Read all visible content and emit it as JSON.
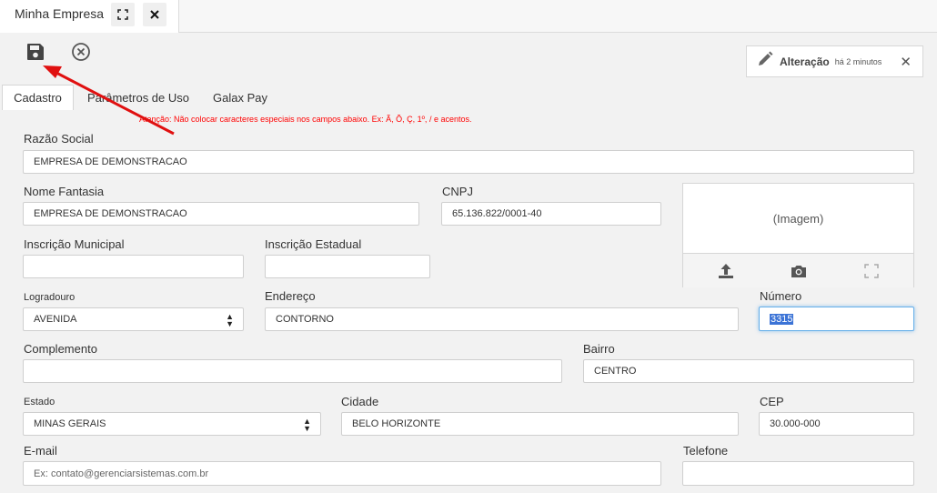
{
  "doc_tab": {
    "title": "Minha Empresa"
  },
  "notice": {
    "title": "Alteração",
    "time": "há 2 minutos",
    "close": "✕"
  },
  "tabs": [
    {
      "label": "Cadastro",
      "active": true
    },
    {
      "label": "Parâmetros de Uso",
      "active": false
    },
    {
      "label": "Galax Pay",
      "active": false
    }
  ],
  "warning": "Atenção: Não colocar caracteres especiais nos campos abaixo. Ex: Ã, Õ, Ç, 1º, / e acentos.",
  "form": {
    "razao_social": {
      "label": "Razão Social",
      "value": "EMPRESA DE DEMONSTRACAO"
    },
    "nome_fantasia": {
      "label": "Nome Fantasia",
      "value": "EMPRESA DE DEMONSTRACAO"
    },
    "cnpj": {
      "label": "CNPJ",
      "value": "65.136.822/0001-40"
    },
    "inscricao_municipal": {
      "label": "Inscrição Municipal",
      "value": ""
    },
    "inscricao_estadual": {
      "label": "Inscrição Estadual",
      "value": ""
    },
    "logradouro": {
      "label": "Logradouro",
      "value": "AVENIDA"
    },
    "endereco": {
      "label": "Endereço",
      "value": "CONTORNO"
    },
    "numero": {
      "label": "Número",
      "value": "3315"
    },
    "complemento": {
      "label": "Complemento",
      "value": ""
    },
    "bairro": {
      "label": "Bairro",
      "value": "CENTRO"
    },
    "estado": {
      "label": "Estado",
      "value": "MINAS GERAIS"
    },
    "cidade": {
      "label": "Cidade",
      "value": "BELO HORIZONTE"
    },
    "cep": {
      "label": "CEP",
      "value": "30.000-000"
    },
    "email": {
      "label": "E-mail",
      "placeholder": "Ex: contato@gerenciarsistemas.com.br"
    },
    "telefone": {
      "label": "Telefone",
      "value": ""
    }
  },
  "image_panel": {
    "label": "(Imagem)"
  },
  "icons": {
    "fullscreen": "fullscreen-icon",
    "close": "close-icon",
    "save": "floppy-disk-icon",
    "cancel": "circle-x-icon",
    "pencil": "pencil-icon",
    "upload": "upload-icon",
    "camera": "camera-icon",
    "expand": "expand-icon",
    "caret": "caret-updown-icon"
  },
  "colors": {
    "warning": "#ff0000",
    "annotation_arrow": "#e01010",
    "focus": "#66afe9",
    "selection": "#3b73d6"
  }
}
